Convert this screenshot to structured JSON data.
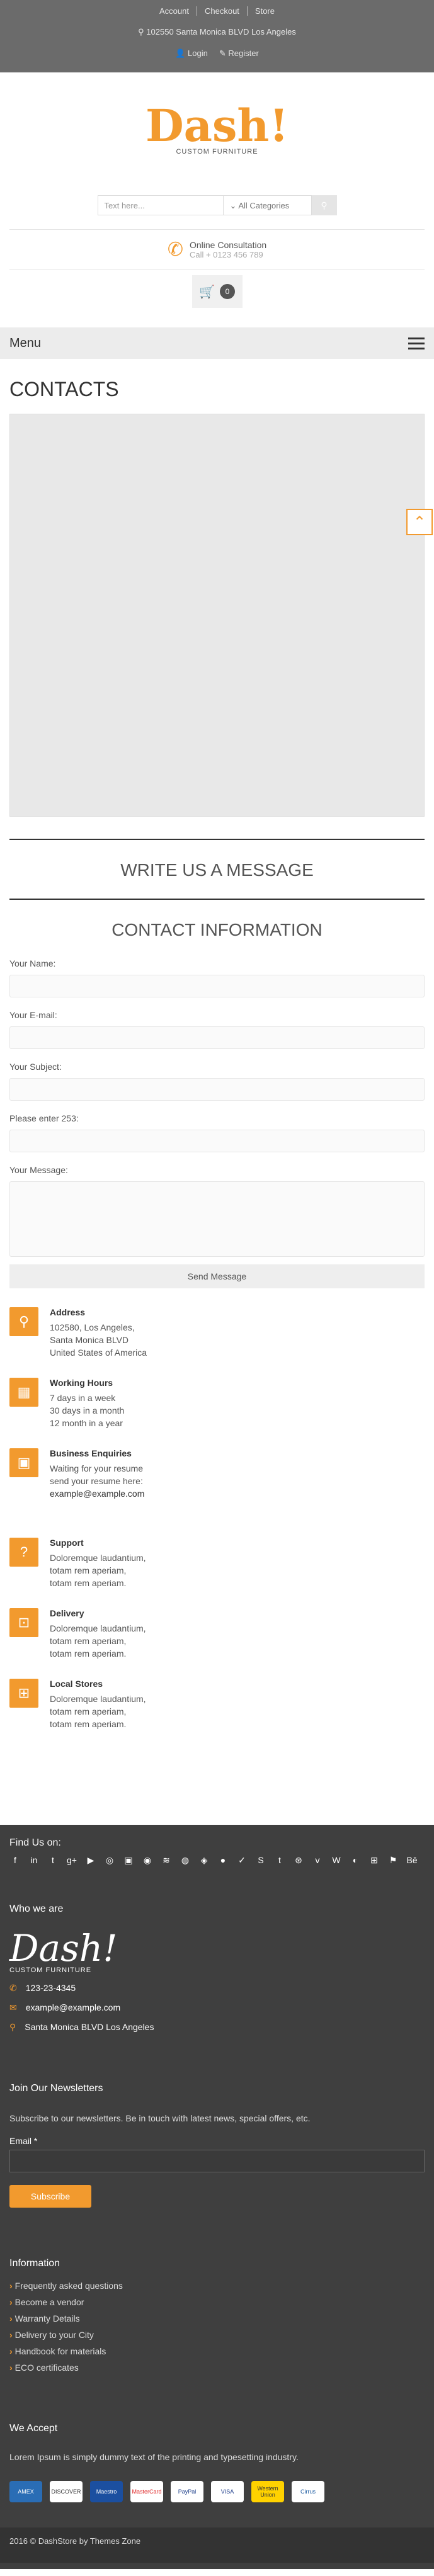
{
  "topbar": {
    "links": [
      "Account",
      "Checkout",
      "Store"
    ],
    "address": "102550 Santa Monica BLVD Los Angeles",
    "login": "Login",
    "register": "Register"
  },
  "logo": {
    "text": "Dash!",
    "sub": "CUSTOM FURNITURE"
  },
  "search": {
    "placeholder": "Text here...",
    "category": "All Categories"
  },
  "consult": {
    "title": "Online Consultation",
    "phone": "Call + 0123 456 789"
  },
  "cart": {
    "count": "0"
  },
  "menu": {
    "label": "Menu"
  },
  "page": {
    "title": "CONTACTS"
  },
  "write": {
    "title": "WRITE US A MESSAGE"
  },
  "contact_info": {
    "title": "CONTACT INFORMATION"
  },
  "form": {
    "name": "Your Name:",
    "email": "Your E-mail:",
    "subject": "Your Subject:",
    "captcha": "Please enter 253:",
    "message": "Your Message:",
    "send": "Send Message"
  },
  "info": [
    {
      "title": "Address",
      "lines": [
        "102580, Los Angeles,",
        "Santa Monica BLVD",
        "United States of America"
      ]
    },
    {
      "title": "Working Hours",
      "lines": [
        "7 days in a week",
        "30 days in a month",
        "12 month in a year"
      ]
    },
    {
      "title": "Business Enquiries",
      "lines": [
        "Waiting for your resume",
        "send your resume here:"
      ],
      "link": "example@example.com"
    },
    {
      "title": "Support",
      "lines": [
        "Doloremque laudantium,",
        "totam rem aperiam,",
        "totam rem aperiam."
      ]
    },
    {
      "title": "Delivery",
      "lines": [
        "Doloremque laudantium,",
        "totam rem aperiam,",
        "totam rem aperiam."
      ]
    },
    {
      "title": "Local Stores",
      "lines": [
        "Doloremque laudantium,",
        "totam rem aperiam,",
        "totam rem aperiam."
      ]
    }
  ],
  "footer": {
    "find_us": "Find Us on:",
    "who_title": "Who we are",
    "logo": "Dash!",
    "logo_sub": "CUSTOM FURNITURE",
    "phone": "123-23-4345",
    "email": "example@example.com",
    "address": "Santa Monica BLVD Los Angeles",
    "news_title": "Join Our Newsletters",
    "news_text": "Subscribe to our newsletters. Be in touch with latest news, special offers, etc.",
    "email_label": "Email *",
    "subscribe": "Subscribe",
    "info_title": "Information",
    "info_links": [
      "Frequently asked questions",
      "Become a vendor",
      "Warranty Details",
      "Delivery to your City",
      "Handbook for materials",
      "ECO certificates"
    ],
    "accept_title": "We Accept",
    "accept_text": "Lorem Ipsum is simply dummy text of the printing and typesetting industry.",
    "cards": [
      "AMEX",
      "DISCOVER",
      "Maestro",
      "MasterCard",
      "PayPal",
      "VISA",
      "Western Union",
      "Cirrus"
    ],
    "copyright": "2016 © DashStore by Themes Zone"
  }
}
